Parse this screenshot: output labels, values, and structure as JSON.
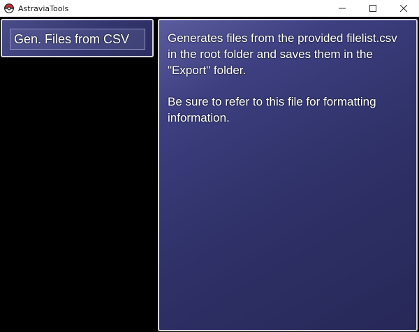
{
  "window": {
    "title": "AstraviaTools",
    "icon": "pokeball-icon",
    "controls": [
      "minimize-icon",
      "maximize-icon",
      "close-icon"
    ]
  },
  "menu": {
    "commands": [
      {
        "label": "Gen. Files from CSV"
      }
    ]
  },
  "help": {
    "paragraphs": [
      "Generates files from the provided filelist.csv in the root folder and saves them in the \"Export\" folder.",
      "Be sure to refer to this file for formatting information."
    ]
  },
  "colors": {
    "window_bg": "#000000",
    "panel_border": "#d8d8e0",
    "panel_gradient_start": "#5a5c9e",
    "panel_gradient_end": "#272858",
    "text": "#ffffff"
  }
}
